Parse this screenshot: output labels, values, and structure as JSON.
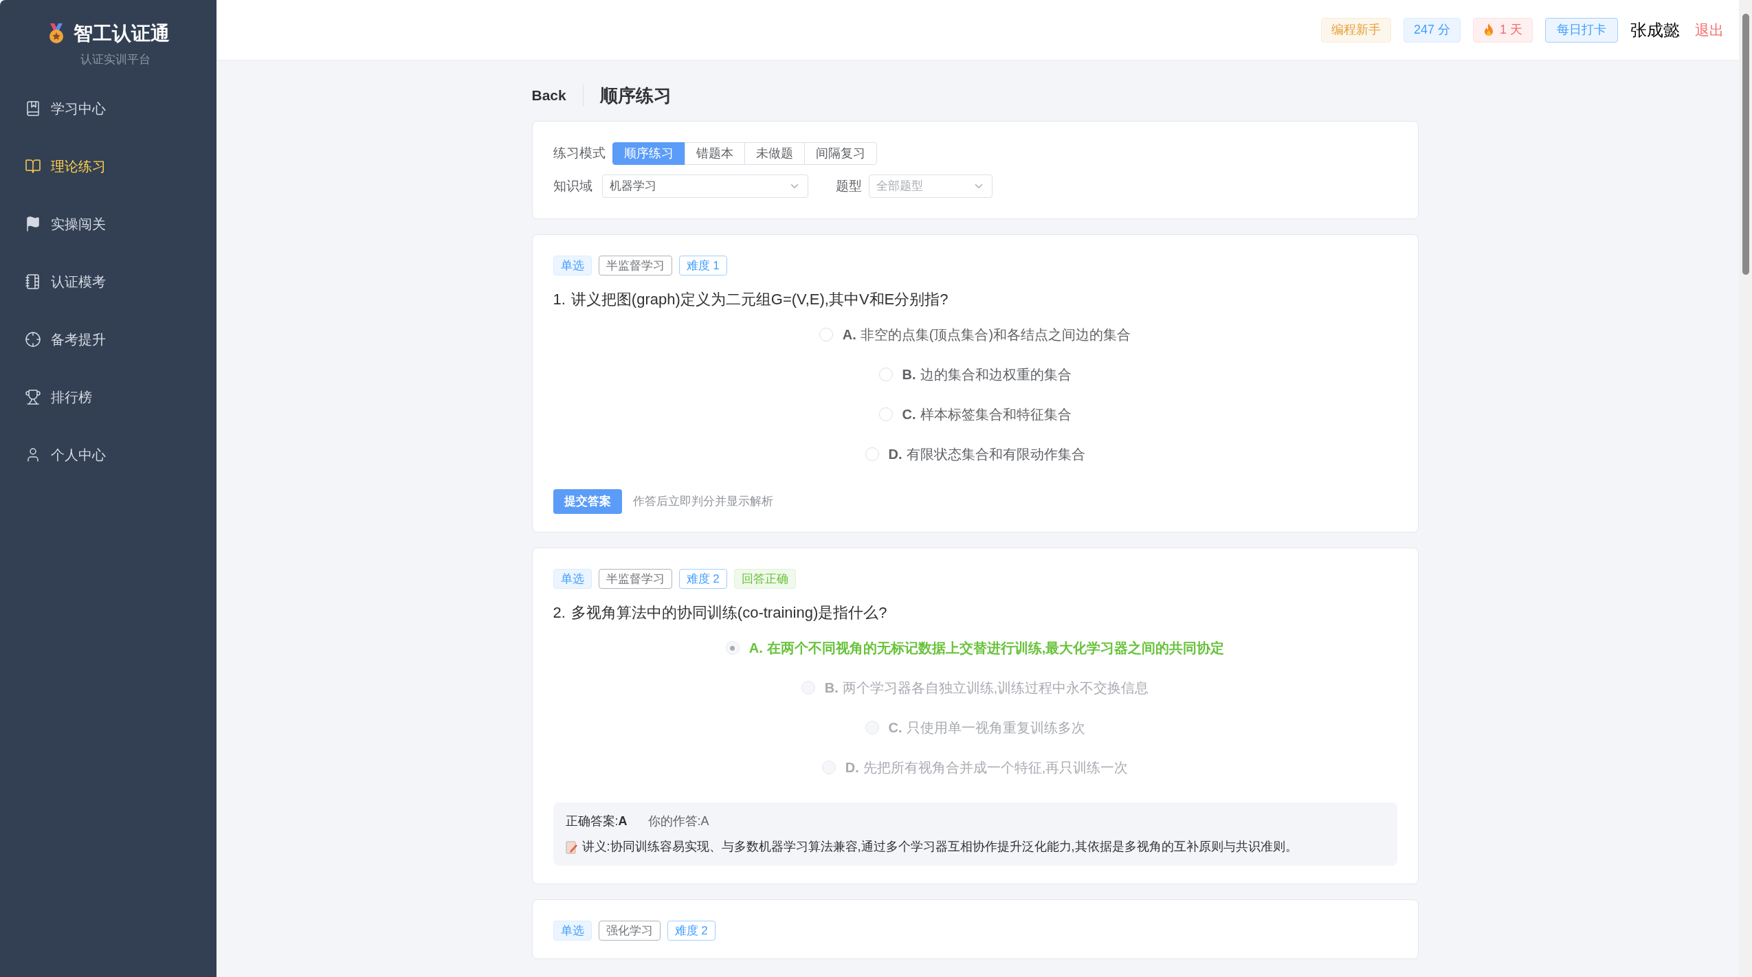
{
  "sidebar": {
    "logo": {
      "title": "智工认证通",
      "subtitle": "认证实训平台"
    },
    "items": [
      {
        "label": "学习中心",
        "selected": false
      },
      {
        "label": "理论练习",
        "selected": true
      },
      {
        "label": "实操闯关",
        "selected": false
      },
      {
        "label": "认证模考",
        "selected": false
      },
      {
        "label": "备考提升",
        "selected": false
      },
      {
        "label": "排行榜",
        "selected": false
      },
      {
        "label": "个人中心",
        "selected": false
      }
    ]
  },
  "header": {
    "badges": [
      {
        "kind": "level",
        "text": "编程新手"
      },
      {
        "kind": "points",
        "text": "247 分"
      },
      {
        "kind": "streak",
        "text": "1 天"
      }
    ],
    "checkin_button": "每日打卡",
    "user_name": "张成懿",
    "logout": "退出"
  },
  "page": {
    "back": "Back",
    "title": "顺序练习"
  },
  "filters": {
    "mode_label": "练习模式",
    "modes": [
      {
        "label": "顺序练习",
        "selected": true
      },
      {
        "label": "错题本",
        "selected": false
      },
      {
        "label": "未做题",
        "selected": false
      },
      {
        "label": "间隔复习",
        "selected": false
      }
    ],
    "domain_label": "知识域",
    "domain_value": "机器学习",
    "type_label": "题型",
    "type_placeholder": "全部题型"
  },
  "questions": [
    {
      "answered": false,
      "tags": [
        {
          "kind": "type",
          "text": "单选"
        },
        {
          "kind": "topic",
          "text": "半监督学习"
        },
        {
          "kind": "difficulty",
          "text": "难度 1"
        }
      ],
      "number": "1.",
      "text": "讲义把图(graph)定义为二元组G=(V,E),其中V和E分别指?",
      "options": [
        {
          "key": "A.",
          "text": "非空的点集(顶点集合)和各结点之间边的集合",
          "selected": false
        },
        {
          "key": "B.",
          "text": "边的集合和边权重的集合",
          "selected": false
        },
        {
          "key": "C.",
          "text": "样本标签集合和特征集合",
          "selected": false
        },
        {
          "key": "D.",
          "text": "有限状态集合和有限动作集合",
          "selected": false
        }
      ],
      "submit_button": "提交答案",
      "hint": "作答后立即判分并显示解析"
    },
    {
      "answered": true,
      "tags": [
        {
          "kind": "type",
          "text": "单选"
        },
        {
          "kind": "topic",
          "text": "半监督学习"
        },
        {
          "kind": "difficulty",
          "text": "难度 2"
        },
        {
          "kind": "result",
          "text": "回答正确"
        }
      ],
      "number": "2.",
      "text": "多视角算法中的协同训练(co-training)是指什么?",
      "options": [
        {
          "key": "A.",
          "text": "在两个不同视角的无标记数据上交替进行训练,最大化学习器之间的共同协定",
          "selected": true,
          "correct": true
        },
        {
          "key": "B.",
          "text": "两个学习器各自独立训练,训练过程中永不交换信息",
          "selected": false,
          "correct": false
        },
        {
          "key": "C.",
          "text": "只使用单一视角重复训练多次",
          "selected": false,
          "correct": false
        },
        {
          "key": "D.",
          "text": "先把所有视角合并成一个特征,再只训练一次",
          "selected": false,
          "correct": false
        }
      ],
      "correct_answer": "正确答案:**A**",
      "your_answer": "你的作答:A",
      "explanation": "讲义:协同训练容易实现、与多数机器学习算法兼容,通过多个学习器互相协作提升泛化能力,其依据是多视角的互补原则与共识准则。"
    },
    {
      "tags": [
        {
          "kind": "type",
          "text": "单选"
        },
        {
          "kind": "topic",
          "text": "强化学习"
        },
        {
          "kind": "difficulty",
          "text": "难度 2"
        }
      ]
    }
  ]
}
